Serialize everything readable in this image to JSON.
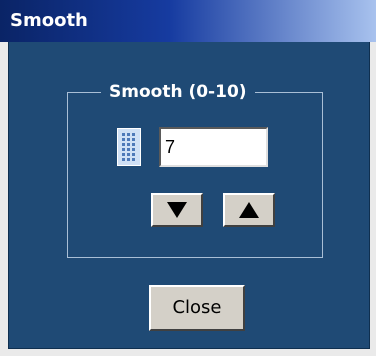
{
  "window": {
    "title": "Smooth"
  },
  "group": {
    "legend": "Smooth (0-10)"
  },
  "smooth_input": {
    "value": "7"
  },
  "buttons": {
    "close_label": "Close"
  },
  "icons": {
    "keypad": "keypad-icon",
    "down": "arrow-down-icon",
    "up": "arrow-up-icon"
  },
  "colors": {
    "client_background": "#1f4a75",
    "title_gradient_start": "#0a2466",
    "title_gradient_end": "#a8c2ee"
  }
}
